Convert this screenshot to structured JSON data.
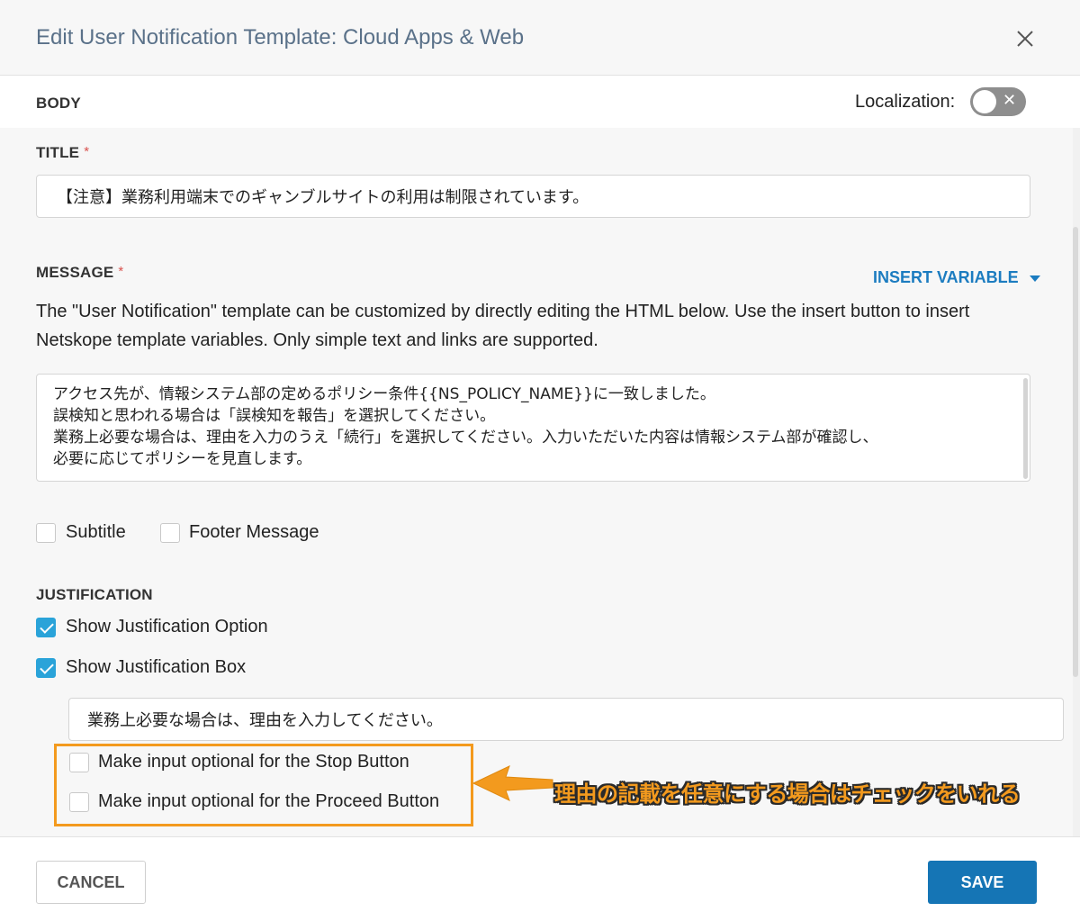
{
  "dialog": {
    "title": "Edit User Notification Template: Cloud Apps & Web"
  },
  "body_section": {
    "label": "BODY",
    "localization_label": "Localization:",
    "localization_enabled": false
  },
  "title_field": {
    "label": "TITLE",
    "required_mark": "*",
    "value": "【注意】業務利用端末でのギャンブルサイトの利用は制限されています。"
  },
  "message_field": {
    "label": "MESSAGE",
    "required_mark": "*",
    "insert_variable_label": "INSERT VARIABLE",
    "description": "The \"User Notification\" template can be customized by directly editing the HTML below. Use the insert button to insert Netskope template variables. Only simple text and links are supported.",
    "lines": [
      "アクセス先が、情報システム部の定めるポリシー条件{{NS_POLICY_NAME}}に一致しました。",
      "誤検知と思われる場合は「誤検知を報告」を選択してください。",
      "業務上必要な場合は、理由を入力のうえ「続行」を選択してください。入力いただいた内容は情報システム部が確認し、",
      "必要に応じてポリシーを見直します。"
    ]
  },
  "options": {
    "subtitle_label": "Subtitle",
    "subtitle_checked": false,
    "footer_label": "Footer Message",
    "footer_checked": false
  },
  "justification": {
    "label": "JUSTIFICATION",
    "show_option_label": "Show Justification Option",
    "show_option_checked": true,
    "show_box_label": "Show Justification Box",
    "show_box_checked": true,
    "box_value": "業務上必要な場合は、理由を入力してください。",
    "optional_stop_label": "Make input optional for the Stop Button",
    "optional_stop_checked": false,
    "optional_proceed_label": "Make input optional for the Proceed Button",
    "optional_proceed_checked": false
  },
  "annotation": {
    "text": "理由の記載を任意にする場合はチェックをいれる",
    "color": "#f39a1e"
  },
  "footer": {
    "cancel_label": "CANCEL",
    "save_label": "SAVE"
  },
  "colors": {
    "accent": "#1575b5",
    "checkbox": "#2aa3d9",
    "link": "#1c7cc0"
  }
}
